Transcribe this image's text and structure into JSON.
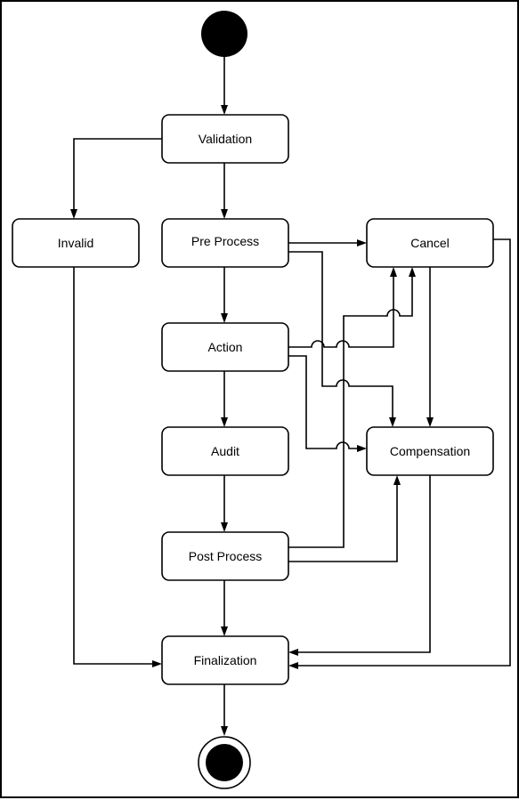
{
  "diagram": {
    "type": "uml-activity",
    "start": {
      "id": "start",
      "label": ""
    },
    "end": {
      "id": "end",
      "label": ""
    },
    "nodes": [
      {
        "id": "validation",
        "label": "Validation"
      },
      {
        "id": "invalid",
        "label": "Invalid"
      },
      {
        "id": "preprocess",
        "label": "Pre Process"
      },
      {
        "id": "cancel",
        "label": "Cancel"
      },
      {
        "id": "action",
        "label": "Action"
      },
      {
        "id": "audit",
        "label": "Audit"
      },
      {
        "id": "compensation",
        "label": "Compensation"
      },
      {
        "id": "postprocess",
        "label": "Post Process"
      },
      {
        "id": "finalization",
        "label": "Finalization"
      }
    ],
    "edges": [
      {
        "from": "start",
        "to": "validation"
      },
      {
        "from": "validation",
        "to": "invalid"
      },
      {
        "from": "validation",
        "to": "preprocess"
      },
      {
        "from": "preprocess",
        "to": "cancel"
      },
      {
        "from": "preprocess",
        "to": "compensation"
      },
      {
        "from": "preprocess",
        "to": "action"
      },
      {
        "from": "action",
        "to": "cancel"
      },
      {
        "from": "action",
        "to": "compensation"
      },
      {
        "from": "action",
        "to": "audit"
      },
      {
        "from": "audit",
        "to": "postprocess"
      },
      {
        "from": "postprocess",
        "to": "cancel"
      },
      {
        "from": "postprocess",
        "to": "compensation"
      },
      {
        "from": "postprocess",
        "to": "finalization"
      },
      {
        "from": "cancel",
        "to": "compensation"
      },
      {
        "from": "cancel",
        "to": "finalization"
      },
      {
        "from": "compensation",
        "to": "finalization"
      },
      {
        "from": "invalid",
        "to": "finalization"
      },
      {
        "from": "finalization",
        "to": "end"
      }
    ]
  }
}
